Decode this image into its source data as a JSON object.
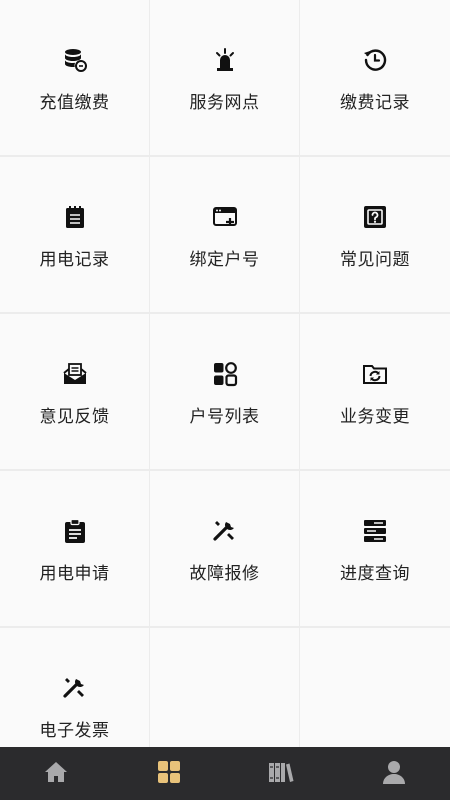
{
  "grid": {
    "items": [
      {
        "label": "充值缴费",
        "icon": "database-coins-icon"
      },
      {
        "label": "服务网点",
        "icon": "siren-light-icon"
      },
      {
        "label": "缴费记录",
        "icon": "history-clock-icon"
      },
      {
        "label": "用电记录",
        "icon": "notepad-icon"
      },
      {
        "label": "绑定户号",
        "icon": "window-plus-icon"
      },
      {
        "label": "常见问题",
        "icon": "question-box-icon"
      },
      {
        "label": "意见反馈",
        "icon": "mail-tray-icon"
      },
      {
        "label": "户号列表",
        "icon": "apps-grid-icon"
      },
      {
        "label": "业务变更",
        "icon": "folder-sync-icon"
      },
      {
        "label": "用电申请",
        "icon": "clipboard-text-icon"
      },
      {
        "label": "故障报修",
        "icon": "tools-wrench-icon"
      },
      {
        "label": "进度查询",
        "icon": "server-stack-icon"
      },
      {
        "label": "电子发票",
        "icon": "tools-wrench-icon"
      }
    ]
  },
  "tabbar": {
    "tabs": [
      {
        "name": "home",
        "icon": "home-icon",
        "active": false
      },
      {
        "name": "services",
        "icon": "grid-icon",
        "active": true
      },
      {
        "name": "library",
        "icon": "books-icon",
        "active": false
      },
      {
        "name": "profile",
        "icon": "user-icon",
        "active": false
      }
    ],
    "active_color": "#e8c27a",
    "inactive_color": "#a9a9ab"
  }
}
